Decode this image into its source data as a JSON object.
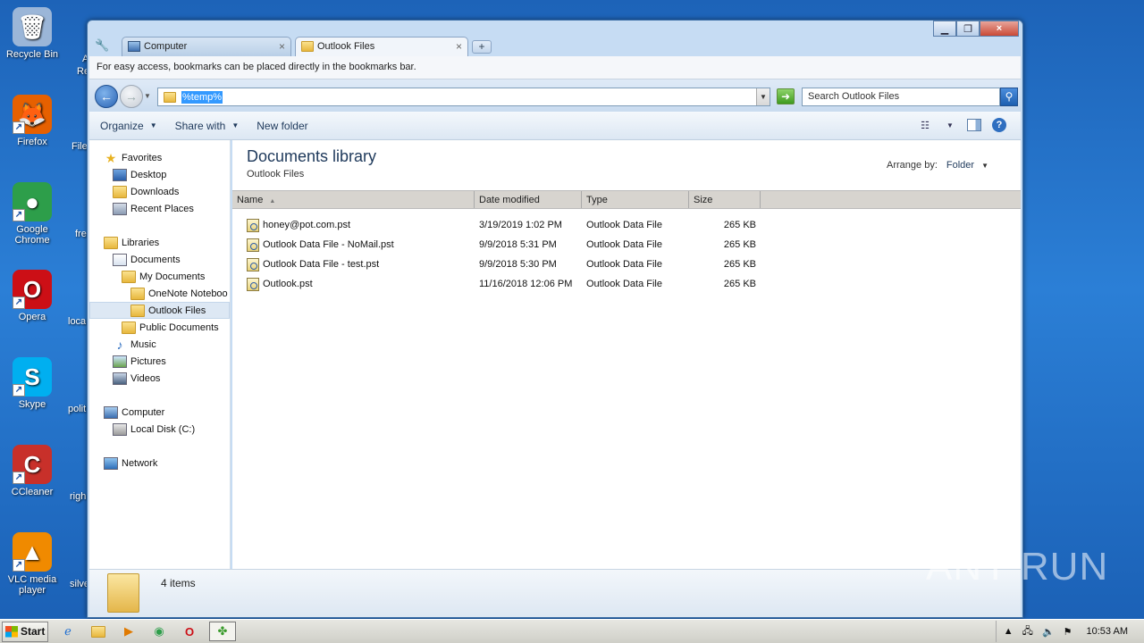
{
  "desktop": {
    "icons": [
      {
        "label": "Recycle Bin",
        "name": "recycle-bin-icon",
        "color": "#9bb6d8",
        "glyph": "🗑"
      },
      {
        "label": "Firefox",
        "name": "firefox-icon",
        "color": "#e66000",
        "glyph": "🦊"
      },
      {
        "label": "Google Chrome",
        "name": "chrome-icon",
        "color": "#2d9e4a",
        "glyph": "●"
      },
      {
        "label": "Opera",
        "name": "opera-icon",
        "color": "#cc0f16",
        "glyph": "O"
      },
      {
        "label": "Skype",
        "name": "skype-icon",
        "color": "#00aff0",
        "glyph": "S"
      },
      {
        "label": "CCleaner",
        "name": "ccleaner-icon",
        "color": "#c8302a",
        "glyph": "C"
      },
      {
        "label": "VLC media player",
        "name": "vlc-icon",
        "color": "#f08a00",
        "glyph": "▲"
      }
    ],
    "partial_labels": [
      "A",
      "Re",
      "File",
      "fre",
      "loca",
      "polit",
      "righ",
      "silve"
    ]
  },
  "window": {
    "tabs": [
      {
        "label": "Computer",
        "active": false
      },
      {
        "label": "Outlook Files",
        "active": true
      }
    ],
    "new_tab": "+",
    "close_glyph": "×",
    "bookmark_bar_text": "For easy access, bookmarks can be placed directly in the bookmarks bar.",
    "address_value": "%temp%",
    "search_placeholder": "Search Outlook Files",
    "toolbar": {
      "organize": "Organize",
      "share_with": "Share with",
      "new_folder": "New folder"
    }
  },
  "nav_pane": {
    "items": [
      {
        "label": "Favorites",
        "icon": "star",
        "indent": 0,
        "section": true
      },
      {
        "label": "Desktop",
        "icon": "desktop",
        "indent": 1
      },
      {
        "label": "Downloads",
        "icon": "folder",
        "indent": 1
      },
      {
        "label": "Recent Places",
        "icon": "recent",
        "indent": 1
      },
      {
        "label": "Libraries",
        "icon": "library",
        "indent": 0,
        "section": true
      },
      {
        "label": "Documents",
        "icon": "documents",
        "indent": 1
      },
      {
        "label": "My Documents",
        "icon": "folder",
        "indent": 2
      },
      {
        "label": "OneNote Noteboo",
        "icon": "folder",
        "indent": 3
      },
      {
        "label": "Outlook Files",
        "icon": "folder",
        "indent": 3,
        "selected": true
      },
      {
        "label": "Public Documents",
        "icon": "folder",
        "indent": 2
      },
      {
        "label": "Music",
        "icon": "music",
        "indent": 1
      },
      {
        "label": "Pictures",
        "icon": "pictures",
        "indent": 1
      },
      {
        "label": "Videos",
        "icon": "videos",
        "indent": 1
      },
      {
        "label": "Computer",
        "icon": "computer",
        "indent": 0,
        "section": true
      },
      {
        "label": "Local Disk (C:)",
        "icon": "disk",
        "indent": 1
      },
      {
        "label": "Network",
        "icon": "network",
        "indent": 0,
        "section": true
      }
    ]
  },
  "content": {
    "title": "Documents library",
    "subtitle": "Outlook Files",
    "arrange_label": "Arrange by:",
    "arrange_value": "Folder",
    "columns": [
      "Name",
      "Date modified",
      "Type",
      "Size"
    ],
    "files": [
      {
        "name": "honey@pot.com.pst",
        "date": "3/19/2019 1:02 PM",
        "type": "Outlook Data File",
        "size": "265 KB"
      },
      {
        "name": "Outlook Data File - NoMail.pst",
        "date": "9/9/2018 5:31 PM",
        "type": "Outlook Data File",
        "size": "265 KB"
      },
      {
        "name": "Outlook Data File - test.pst",
        "date": "9/9/2018 5:30 PM",
        "type": "Outlook Data File",
        "size": "265 KB"
      },
      {
        "name": "Outlook.pst",
        "date": "11/16/2018 12:06 PM",
        "type": "Outlook Data File",
        "size": "265 KB"
      }
    ]
  },
  "details": {
    "item_count": "4 items"
  },
  "taskbar": {
    "start_label": "Start",
    "clock": "10:53 AM"
  },
  "watermark": "ANY RUN"
}
